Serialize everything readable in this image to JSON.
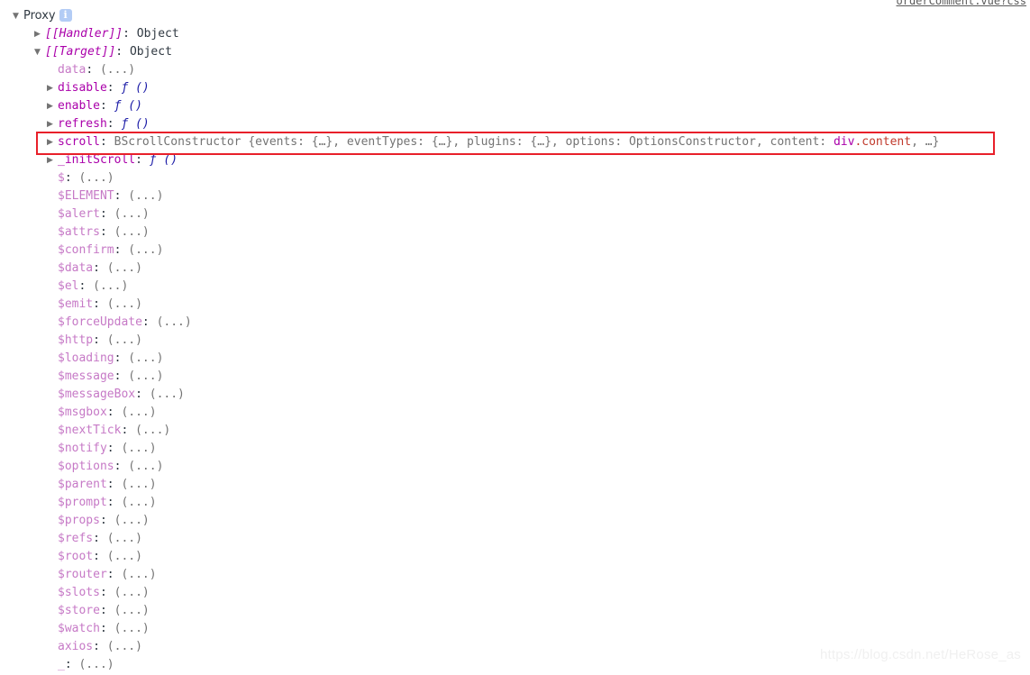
{
  "source_link": {
    "text": "orderComment.vue?css"
  },
  "watermark": {
    "text": "https://blog.csdn.net/HeRose_as"
  },
  "colors": {
    "highlight_box": "#e8202a",
    "property_name": "#c679c6",
    "internal_slot": "#aa00aa",
    "function_value": "#1a1aa6",
    "value_muted": "#737373",
    "dom_class": "#c0392b",
    "info_badge": "#b3ccf5",
    "text": "#303942",
    "background": "#ffffff"
  },
  "tree": {
    "root": {
      "arrow": "▼",
      "label": "Proxy",
      "badge": "i",
      "badge_name": "info-icon"
    },
    "rows": [
      {
        "arrow": "▶",
        "indent": "lv2",
        "key": "[[Handler]]",
        "key_class": "k-internal",
        "colon": ": ",
        "value": "Object",
        "value_class": "val-obj"
      },
      {
        "arrow": "▼",
        "indent": "lv2",
        "key": "[[Target]]",
        "key_class": "k-internal",
        "colon": ": ",
        "value": "Object",
        "value_class": "val-obj"
      },
      {
        "arrow": "",
        "indent": "lv3np",
        "key": "data",
        "key_class": "k-prop",
        "colon": ": ",
        "value": "(...)",
        "value_class": "val-dots"
      },
      {
        "arrow": "▶",
        "indent": "lv3",
        "key": "disable",
        "key_class": "k-own",
        "colon": ": ",
        "value": "ƒ ()",
        "value_class": "val-fn"
      },
      {
        "arrow": "▶",
        "indent": "lv3",
        "key": "enable",
        "key_class": "k-own",
        "colon": ": ",
        "value": "ƒ ()",
        "value_class": "val-fn"
      },
      {
        "arrow": "▶",
        "indent": "lv3",
        "key": "refresh",
        "key_class": "k-own",
        "colon": ": ",
        "value": "ƒ ()",
        "value_class": "val-fn"
      },
      {
        "arrow": "▶",
        "indent": "lv3",
        "key": "_initScroll",
        "key_class": "k-own",
        "colon": ": ",
        "value": "ƒ ()",
        "value_class": "val-fn"
      },
      {
        "arrow": "",
        "indent": "lv3np",
        "key": "$",
        "key_class": "k-prop",
        "colon": ": ",
        "value": "(...)",
        "value_class": "val-dots"
      },
      {
        "arrow": "",
        "indent": "lv3np",
        "key": "$ELEMENT",
        "key_class": "k-prop",
        "colon": ": ",
        "value": "(...)",
        "value_class": "val-dots"
      },
      {
        "arrow": "",
        "indent": "lv3np",
        "key": "$alert",
        "key_class": "k-prop",
        "colon": ": ",
        "value": "(...)",
        "value_class": "val-dots"
      },
      {
        "arrow": "",
        "indent": "lv3np",
        "key": "$attrs",
        "key_class": "k-prop",
        "colon": ": ",
        "value": "(...)",
        "value_class": "val-dots"
      },
      {
        "arrow": "",
        "indent": "lv3np",
        "key": "$confirm",
        "key_class": "k-prop",
        "colon": ": ",
        "value": "(...)",
        "value_class": "val-dots"
      },
      {
        "arrow": "",
        "indent": "lv3np",
        "key": "$data",
        "key_class": "k-prop",
        "colon": ": ",
        "value": "(...)",
        "value_class": "val-dots"
      },
      {
        "arrow": "",
        "indent": "lv3np",
        "key": "$el",
        "key_class": "k-prop",
        "colon": ": ",
        "value": "(...)",
        "value_class": "val-dots"
      },
      {
        "arrow": "",
        "indent": "lv3np",
        "key": "$emit",
        "key_class": "k-prop",
        "colon": ": ",
        "value": "(...)",
        "value_class": "val-dots"
      },
      {
        "arrow": "",
        "indent": "lv3np",
        "key": "$forceUpdate",
        "key_class": "k-prop",
        "colon": ": ",
        "value": "(...)",
        "value_class": "val-dots"
      },
      {
        "arrow": "",
        "indent": "lv3np",
        "key": "$http",
        "key_class": "k-prop",
        "colon": ": ",
        "value": "(...)",
        "value_class": "val-dots"
      },
      {
        "arrow": "",
        "indent": "lv3np",
        "key": "$loading",
        "key_class": "k-prop",
        "colon": ": ",
        "value": "(...)",
        "value_class": "val-dots"
      },
      {
        "arrow": "",
        "indent": "lv3np",
        "key": "$message",
        "key_class": "k-prop",
        "colon": ": ",
        "value": "(...)",
        "value_class": "val-dots"
      },
      {
        "arrow": "",
        "indent": "lv3np",
        "key": "$messageBox",
        "key_class": "k-prop",
        "colon": ": ",
        "value": "(...)",
        "value_class": "val-dots"
      },
      {
        "arrow": "",
        "indent": "lv3np",
        "key": "$msgbox",
        "key_class": "k-prop",
        "colon": ": ",
        "value": "(...)",
        "value_class": "val-dots"
      },
      {
        "arrow": "",
        "indent": "lv3np",
        "key": "$nextTick",
        "key_class": "k-prop",
        "colon": ": ",
        "value": "(...)",
        "value_class": "val-dots"
      },
      {
        "arrow": "",
        "indent": "lv3np",
        "key": "$notify",
        "key_class": "k-prop",
        "colon": ": ",
        "value": "(...)",
        "value_class": "val-dots"
      },
      {
        "arrow": "",
        "indent": "lv3np",
        "key": "$options",
        "key_class": "k-prop",
        "colon": ": ",
        "value": "(...)",
        "value_class": "val-dots"
      },
      {
        "arrow": "",
        "indent": "lv3np",
        "key": "$parent",
        "key_class": "k-prop",
        "colon": ": ",
        "value": "(...)",
        "value_class": "val-dots"
      },
      {
        "arrow": "",
        "indent": "lv3np",
        "key": "$prompt",
        "key_class": "k-prop",
        "colon": ": ",
        "value": "(...)",
        "value_class": "val-dots"
      },
      {
        "arrow": "",
        "indent": "lv3np",
        "key": "$props",
        "key_class": "k-prop",
        "colon": ": ",
        "value": "(...)",
        "value_class": "val-dots"
      },
      {
        "arrow": "",
        "indent": "lv3np",
        "key": "$refs",
        "key_class": "k-prop",
        "colon": ": ",
        "value": "(...)",
        "value_class": "val-dots"
      },
      {
        "arrow": "",
        "indent": "lv3np",
        "key": "$root",
        "key_class": "k-prop",
        "colon": ": ",
        "value": "(...)",
        "value_class": "val-dots"
      },
      {
        "arrow": "",
        "indent": "lv3np",
        "key": "$router",
        "key_class": "k-prop",
        "colon": ": ",
        "value": "(...)",
        "value_class": "val-dots"
      },
      {
        "arrow": "",
        "indent": "lv3np",
        "key": "$slots",
        "key_class": "k-prop",
        "colon": ": ",
        "value": "(...)",
        "value_class": "val-dots"
      },
      {
        "arrow": "",
        "indent": "lv3np",
        "key": "$store",
        "key_class": "k-prop",
        "colon": ": ",
        "value": "(...)",
        "value_class": "val-dots"
      },
      {
        "arrow": "",
        "indent": "lv3np",
        "key": "$watch",
        "key_class": "k-prop",
        "colon": ": ",
        "value": "(...)",
        "value_class": "val-dots"
      },
      {
        "arrow": "",
        "indent": "lv3np",
        "key": "axios",
        "key_class": "k-prop",
        "colon": ": ",
        "value": "(...)",
        "value_class": "val-dots"
      },
      {
        "arrow": "",
        "indent": "lv3np",
        "key": "_",
        "key_class": "k-prop",
        "colon": ": ",
        "value": "(...)",
        "value_class": "val-dots"
      }
    ],
    "scroll_row": {
      "arrow": "▶",
      "key": "scroll",
      "colon": ": ",
      "constructor": "BScrollConstructor ",
      "preview_open": "{events: {…}, eventTypes: {…}, plugins: {…}, options: OptionsConstructor, content: ",
      "dom_tag": "div",
      "dom_class": ".content",
      "preview_close": ", …}"
    }
  }
}
